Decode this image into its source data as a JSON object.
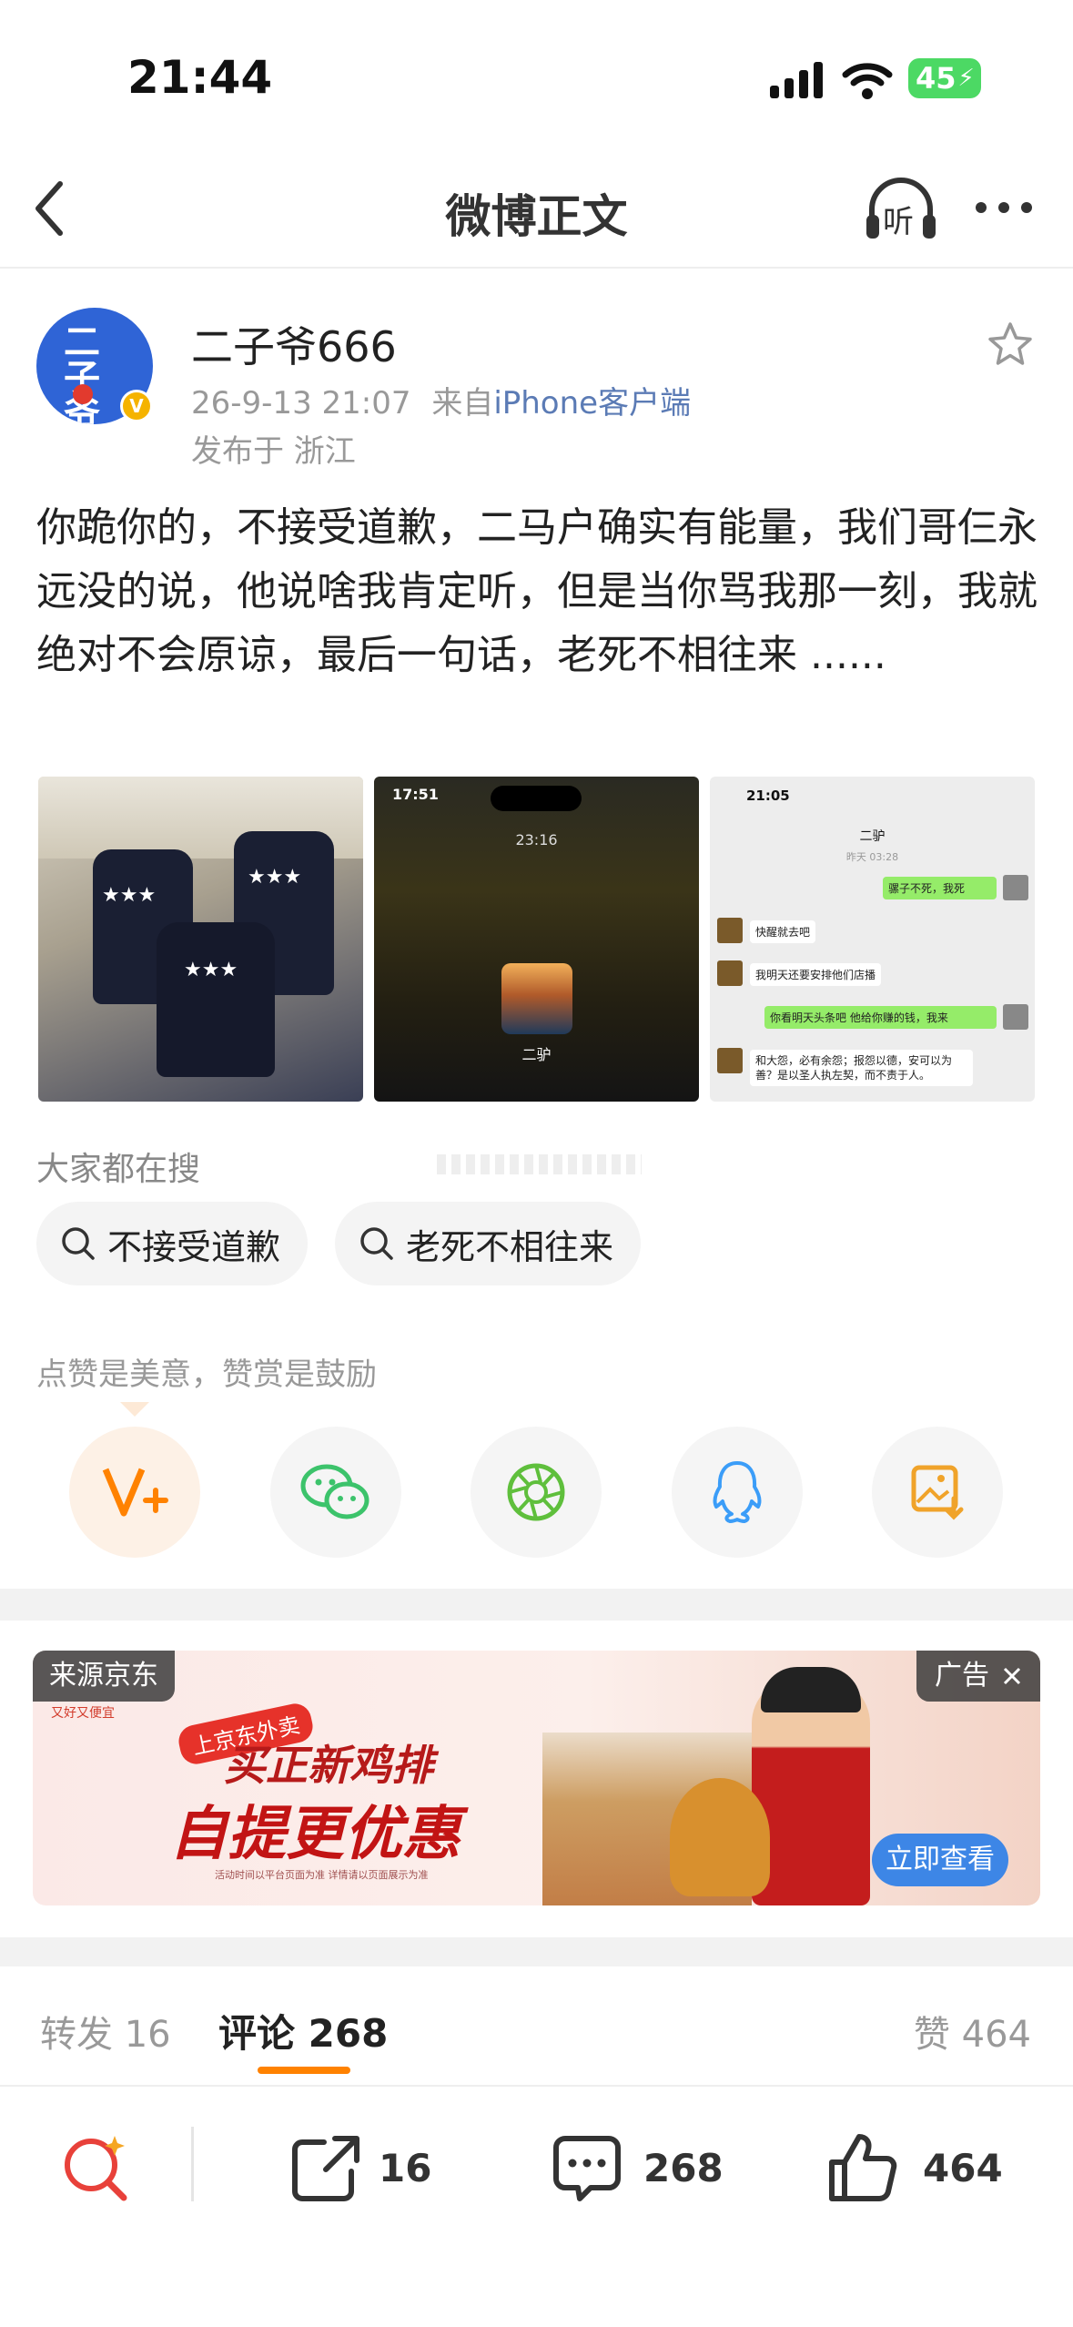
{
  "status_bar": {
    "time": "21:44",
    "battery": "45"
  },
  "nav": {
    "title": "微博正文",
    "listen_label": "听"
  },
  "post": {
    "username": "二子爷666",
    "datetime": "26-9-13 21:07",
    "source_prefix": "来自",
    "source": "iPhone客户端",
    "location": "发布于 浙江",
    "text": "你跪你的，不接受道歉，二马户确实有能量，我们哥仨永远没的说，他说啥我肯定听，但是当你骂我那一刻，我就绝对不会原谅，最后一句话，老死不相往来 ......",
    "images": [
      {
        "alt": "三人合影"
      },
      {
        "status_time": "17:51",
        "timer": "23:16",
        "caption": "二驴"
      },
      {
        "status_time": "21:05",
        "contact": "二驴",
        "date_label": "昨天 03:28",
        "messages": [
          {
            "side": "right",
            "text": "骡子不死，我死"
          },
          {
            "side": "left",
            "text": "快醒就去吧"
          },
          {
            "side": "left",
            "text": "我明天还要安排他们店播"
          },
          {
            "side": "right",
            "text": "你看明天头条吧 他给你赚的钱，我来"
          },
          {
            "side": "left",
            "text": "和大怨，必有余怨；报怨以德，安可以为善？是以圣人执左契，而不责于人。"
          }
        ]
      }
    ]
  },
  "hot_search": {
    "label": "大家都在搜",
    "chips": [
      "不接受道歉",
      "老死不相往来"
    ]
  },
  "praise": {
    "label": "点赞是美意，赞赏是鼓励",
    "share_targets": [
      "v-plus-reward",
      "wechat",
      "moments",
      "qq",
      "save-image"
    ]
  },
  "ad": {
    "source_tag": "来源京东",
    "ad_tag": "广告",
    "brand_small": "又好又便宜",
    "promo_badge": "上京东外卖",
    "headline1": "买正新鸡排",
    "headline2": "自提更优惠",
    "fine_print": "活动时间以平台页面为准 详情请以页面展示为准",
    "cta": "立即查看"
  },
  "tabs": {
    "repost_label": "转发",
    "repost_count": "16",
    "comment_label": "评论",
    "comment_count": "268",
    "like_label": "赞",
    "like_count": "464"
  },
  "bottom_bar": {
    "repost_count": "16",
    "comment_count": "268",
    "like_count": "464"
  },
  "colors": {
    "accent": "#ff8200",
    "link": "#5b7bb5",
    "vip": "#f5b300",
    "wechat": "#3cc36b",
    "qq": "#3b9df8"
  }
}
